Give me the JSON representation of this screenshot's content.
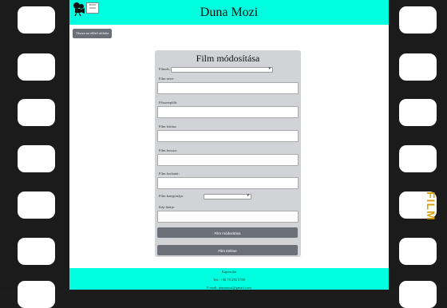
{
  "header": {
    "site_title": "Duna Mozi",
    "logo_text": "DUNA MOZI"
  },
  "nav": {
    "back_label": "Vissza az előző oldalra"
  },
  "form": {
    "title": "Film módosítása",
    "fields": {
      "select_film_label": "Filmek:",
      "name_label": "Film neve:",
      "director_label": "Főszereplők:",
      "description_label": "Film leírása:",
      "duration_label": "Film hossza:",
      "release_label": "Film korhatár:",
      "category_label": "Film kategóriája:",
      "image_label": "Kép linkje:"
    },
    "modify_button": "Film módosítása",
    "delete_button": "Film törlése"
  },
  "footer": {
    "contact_title": "Kapcsolat",
    "phone": "Tel.: +36 70 256 5789",
    "email": "E-mail: dunamozi@gmail.com"
  },
  "side_text": "FILM",
  "colors": {
    "accent": "#00ffde",
    "button": "#6b7078",
    "card": "#d2d3d6"
  }
}
